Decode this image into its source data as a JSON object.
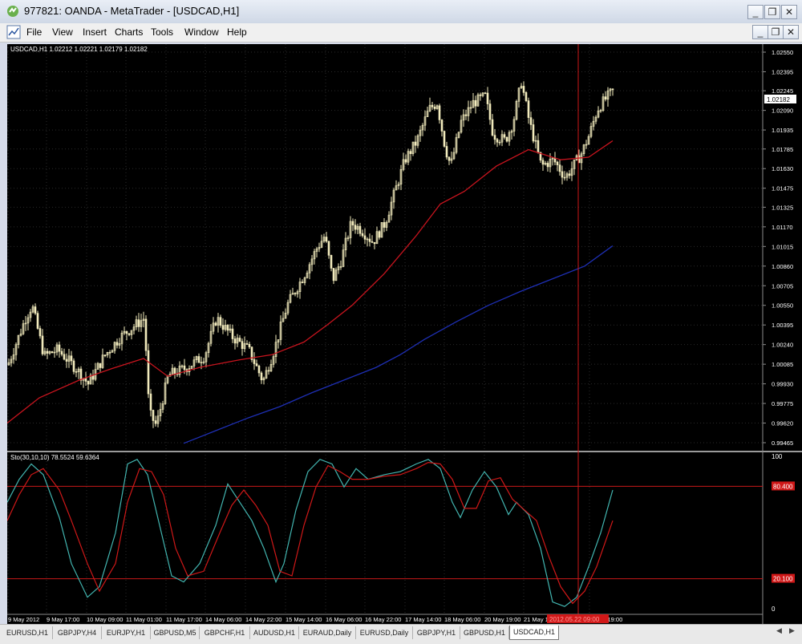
{
  "window": {
    "title": "977821: OANDA - MetaTrader - [USDCAD,H1]",
    "minimize_label": "_",
    "restore_label": "❐",
    "close_label": "✕"
  },
  "menu": [
    "File",
    "View",
    "Insert",
    "Charts",
    "Tools",
    "Window",
    "Help"
  ],
  "chart": {
    "header": "USDCAD,H1  1.02212 1.02221 1.02179 1.02182",
    "current_price": "1.02182",
    "price_ticks": [
      "1.02550",
      "1.02395",
      "1.02245",
      "1.02090",
      "1.01935",
      "1.01785",
      "1.01630",
      "1.01475",
      "1.01325",
      "1.01170",
      "1.01015",
      "1.00860",
      "1.00705",
      "1.00550",
      "1.00395",
      "1.00240",
      "1.00085",
      "0.99930",
      "0.99775",
      "0.99620",
      "0.99465"
    ],
    "indicator_header": "Sto(30,10,10) 78.5524 59.6364",
    "indicator_ticks": [
      "100",
      "0"
    ],
    "level_80": "80.400",
    "level_20": "20.100",
    "time_ticks": [
      "9 May 2012",
      "9 May 17:00",
      "10 May 09:00",
      "11 May 01:00",
      "11 May 17:00",
      "14 May 06:00",
      "14 May 22:00",
      "15 May 14:00",
      "16 May 06:00",
      "16 May 22:00",
      "17 May 14:00",
      "18 May 06:00",
      "20 May 19:00",
      "21 May 11:00",
      "2012.05.22 09:00",
      "2 May 19:00"
    ],
    "crosshair_time": "2012.05.22 09:00",
    "colors": {
      "background": "#000000",
      "candle": "#f2ebbd",
      "ma_fast": "#c8141e",
      "ma_slow": "#1e2fb4",
      "stoch_main": "#42b5b0",
      "stoch_signal": "#d01818",
      "crosshair": "#d11818"
    }
  },
  "tabs": [
    "EURUSD,H1",
    "GBPJPY,H4",
    "EURJPY,H1",
    "GBPUSD,M5",
    "GBPCHF,H1",
    "AUDUSD,H1",
    "EURAUD,Daily",
    "EURUSD,Daily",
    "GBPJPY,H1",
    "GBPUSD,H1",
    "USDCAD,H1"
  ],
  "active_tab": "USDCAD,H1",
  "scroll": {
    "left": "◀",
    "right": "▶"
  }
}
